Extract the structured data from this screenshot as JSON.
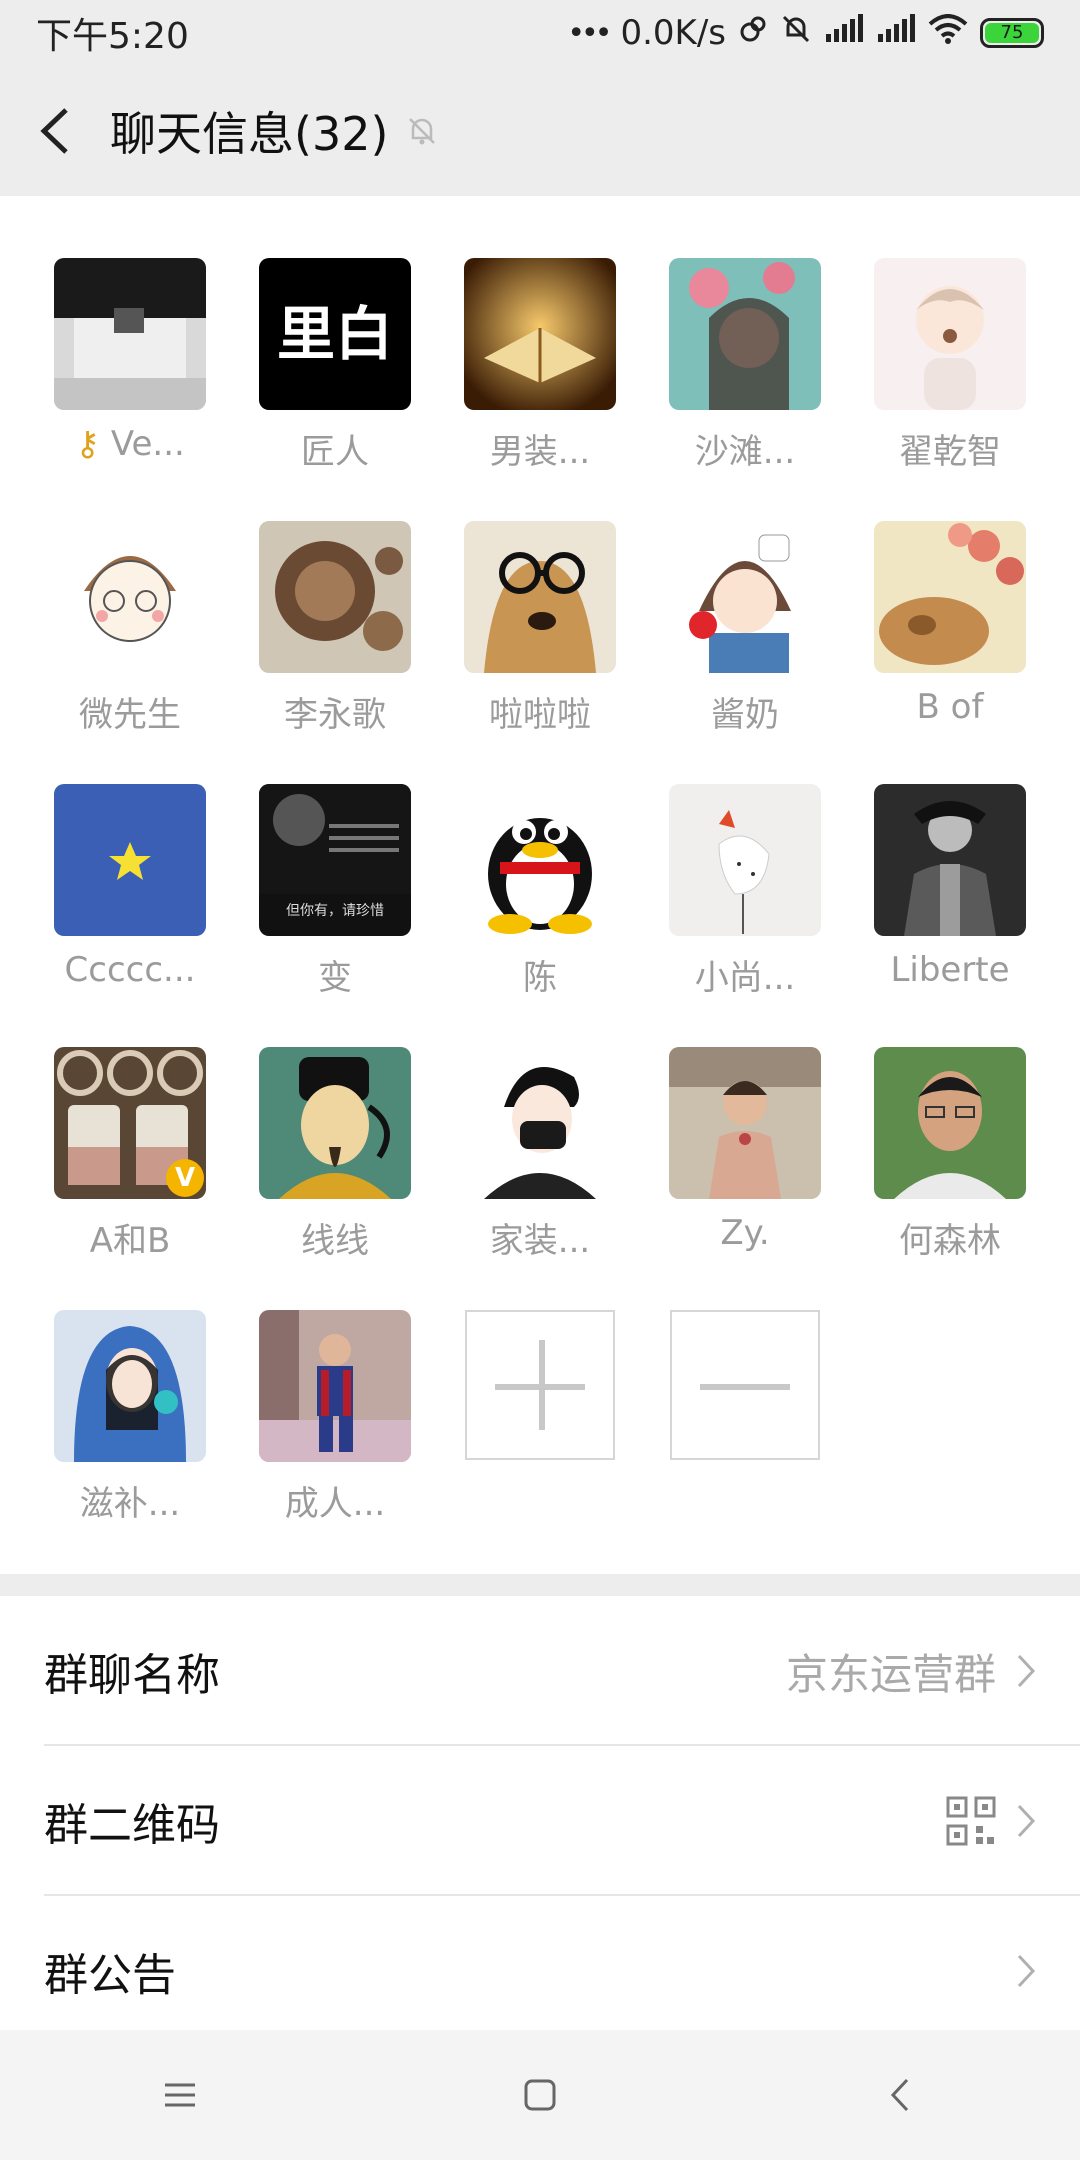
{
  "status_bar": {
    "time": "下午5:20",
    "network_speed": "0.0K/s",
    "battery": "75"
  },
  "header": {
    "title": "聊天信息(32)"
  },
  "members": [
    {
      "name": "Ve...",
      "has_key": true
    },
    {
      "name": "匠人"
    },
    {
      "name": "男装..."
    },
    {
      "name": "沙滩..."
    },
    {
      "name": "翟乾智"
    },
    {
      "name": "微先生"
    },
    {
      "name": "李永歌"
    },
    {
      "name": "啦啦啦"
    },
    {
      "name": "酱奶"
    },
    {
      "name": "B of"
    },
    {
      "name": "Ccccc..."
    },
    {
      "name": "变"
    },
    {
      "name": "陈"
    },
    {
      "name": "小尚..."
    },
    {
      "name": "Liberte"
    },
    {
      "name": "A和B",
      "badge": "V"
    },
    {
      "name": "线线"
    },
    {
      "name": "家装..."
    },
    {
      "name": "Zy."
    },
    {
      "name": "何森林"
    },
    {
      "name": "滋补..."
    },
    {
      "name": "成人..."
    }
  ],
  "avatar_texts": {
    "m2": "里白",
    "m12": "但你有，请珍惜"
  },
  "settings": {
    "group_name_label": "群聊名称",
    "group_name_value": "京东运营群",
    "qr_label": "群二维码",
    "notice_label": "群公告"
  },
  "colors": {
    "background": "#ededed",
    "accent_battery": "#3bd53b",
    "muted_text": "#9b9b9b"
  }
}
